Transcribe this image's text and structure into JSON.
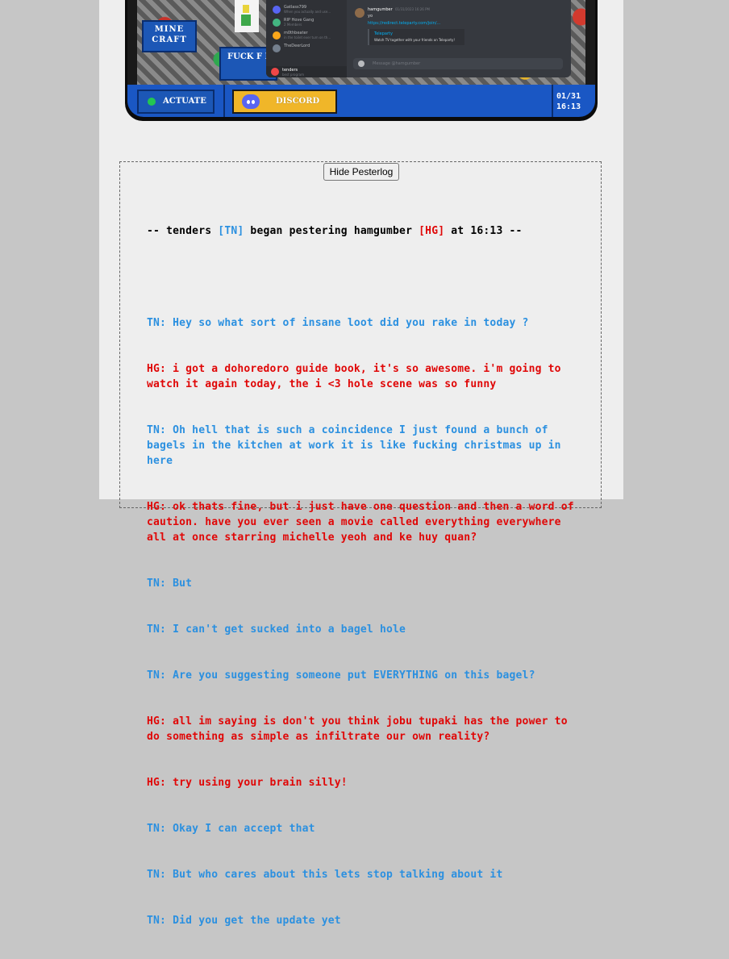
{
  "panel": {
    "minecraft_label": "MINE CRAFT",
    "fuck_label": "FUCK F FUCK.",
    "actuate_label": "ACTUATE",
    "discord_label": "DISCORD",
    "clock_date": "01/31",
    "clock_time": "16:13",
    "discord_window": {
      "dm_items": [
        {
          "name": "Gatlass799",
          "sub": "When you actually and use..."
        },
        {
          "name": "RIP Hove Gang",
          "sub": "2 Members"
        },
        {
          "name": "m0thbeater",
          "sub": "in the toilet ever turn on th..."
        },
        {
          "name": "TheDeerLord",
          "sub": ""
        },
        {
          "name": "tenders",
          "sub": "best program"
        }
      ],
      "message_author": "hamgumber",
      "message_time": "01/31/2023 16:26 PM",
      "message_text": "yo",
      "message_link": "https://redirect.teleparty.com/join/...",
      "embed_title": "Teleparty",
      "embed_desc": "Watch TV together with your friends on Teleparty!",
      "input_placeholder": "Message @hamgumber"
    },
    "accent_blue": "#1a57c4",
    "discord_yellow": "#f0b629"
  },
  "pesterlog": {
    "hide_button": "Hide Pesterlog",
    "begin": {
      "prefix": "-- tenders ",
      "tag1": "[TN]",
      "mid": " began pestering hamgumber ",
      "tag2": "[HG]",
      "suffix": " at 16:13 --"
    },
    "colors": {
      "TN": "#2b90e0",
      "HG": "#e00707"
    },
    "lines": [
      {
        "speaker": "TN",
        "text": "TN: Hey so what sort of insane loot did you rake in today ?"
      },
      {
        "speaker": "HG",
        "text": "HG: i got a dohoredoro guide book, it's so awesome. i'm going to watch it again today, the i <3 hole scene was so funny"
      },
      {
        "speaker": "TN",
        "text": "TN: Oh hell that is such a coincidence I just found a bunch of bagels in the kitchen at work it is like fucking christmas up in here"
      },
      {
        "speaker": "HG",
        "text": "HG: ok thats fine, but i just have one question and then a word of caution. have you ever seen a movie called everything everywhere all at once starring michelle yeoh and ke huy quan?"
      },
      {
        "speaker": "TN",
        "text": "TN: But"
      },
      {
        "speaker": "TN",
        "text": "TN: I can't get sucked into a bagel hole"
      },
      {
        "speaker": "TN",
        "text": "TN: Are you suggesting someone put EVERYTHING on this bagel?"
      },
      {
        "speaker": "HG",
        "text": "HG: all im saying is don't you think jobu tupaki has the power to do something as simple as infiltrate our own reality?"
      },
      {
        "speaker": "HG",
        "text": "HG: try using your brain silly!"
      },
      {
        "speaker": "TN",
        "text": "TN: Okay I can accept that"
      },
      {
        "speaker": "TN",
        "text": "TN: But who cares about this lets stop talking about it"
      },
      {
        "speaker": "TN",
        "text": "TN: Did you get the update yet"
      }
    ]
  }
}
